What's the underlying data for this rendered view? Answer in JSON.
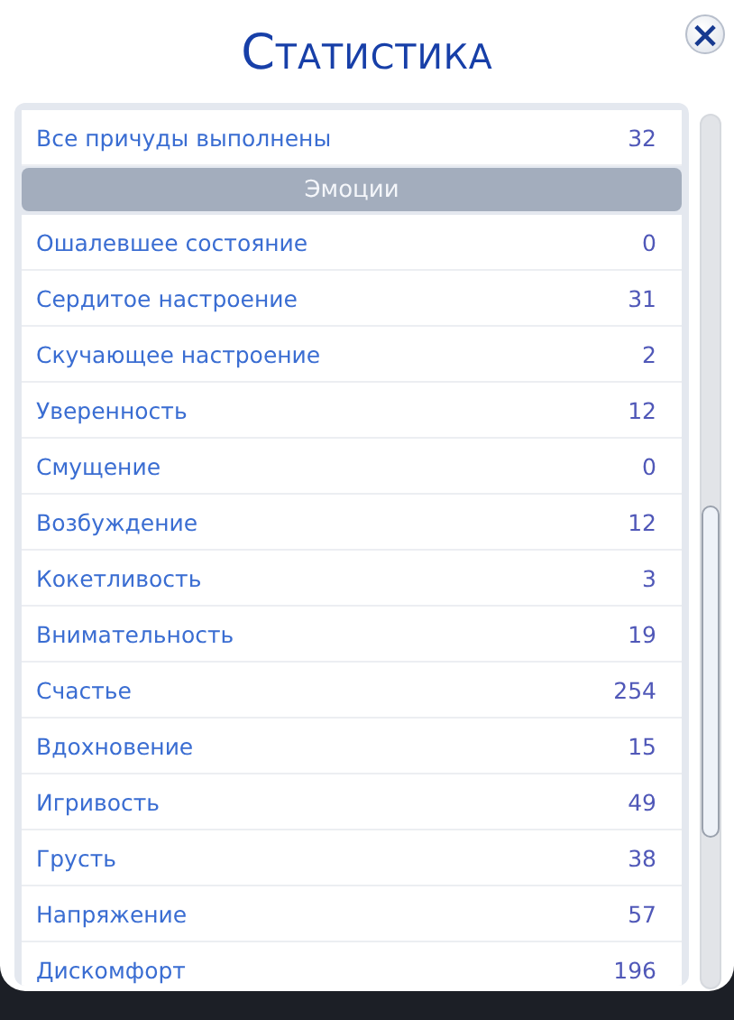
{
  "window": {
    "title": "Статистика",
    "close": "×"
  },
  "rows": [
    {
      "kind": "stat",
      "label": "Все причуды выполнены",
      "value": "32"
    },
    {
      "kind": "header",
      "label": "Эмоции"
    },
    {
      "kind": "stat",
      "label": "Ошалевшее состояние",
      "value": "0"
    },
    {
      "kind": "stat",
      "label": "Сердитое настроение",
      "value": "31"
    },
    {
      "kind": "stat",
      "label": "Скучающее настроение",
      "value": "2"
    },
    {
      "kind": "stat",
      "label": "Уверенность",
      "value": "12"
    },
    {
      "kind": "stat",
      "label": "Смущение",
      "value": "0"
    },
    {
      "kind": "stat",
      "label": "Возбуждение",
      "value": "12"
    },
    {
      "kind": "stat",
      "label": "Кокетливость",
      "value": "3"
    },
    {
      "kind": "stat",
      "label": "Внимательность",
      "value": "19"
    },
    {
      "kind": "stat",
      "label": "Счастье",
      "value": "254"
    },
    {
      "kind": "stat",
      "label": "Вдохновение",
      "value": "15"
    },
    {
      "kind": "stat",
      "label": "Игривость",
      "value": "49"
    },
    {
      "kind": "stat",
      "label": "Грусть",
      "value": "38"
    },
    {
      "kind": "stat",
      "label": "Напряжение",
      "value": "57"
    },
    {
      "kind": "stat",
      "label": "Дискомфорт",
      "value": "196"
    }
  ]
}
